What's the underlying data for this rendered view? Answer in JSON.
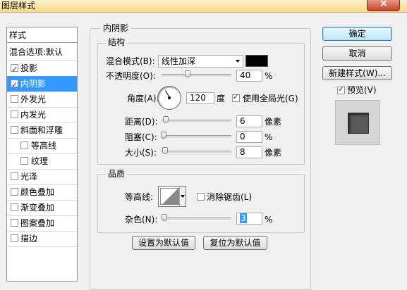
{
  "window": {
    "title": "图层样式"
  },
  "sidebar": {
    "header": "样式",
    "items": [
      {
        "label": "混合选项:默认",
        "checkbox": false,
        "checked": false,
        "selected": false
      },
      {
        "label": "投影",
        "checkbox": true,
        "checked": true,
        "selected": false
      },
      {
        "label": "内阴影",
        "checkbox": true,
        "checked": true,
        "selected": true
      },
      {
        "label": "外发光",
        "checkbox": true,
        "checked": false,
        "selected": false
      },
      {
        "label": "内发光",
        "checkbox": true,
        "checked": false,
        "selected": false
      },
      {
        "label": "斜面和浮雕",
        "checkbox": true,
        "checked": false,
        "selected": false
      },
      {
        "label": "等高线",
        "checkbox": true,
        "checked": false,
        "selected": false,
        "indent": true
      },
      {
        "label": "纹理",
        "checkbox": true,
        "checked": false,
        "selected": false,
        "indent": true
      },
      {
        "label": "光泽",
        "checkbox": true,
        "checked": false,
        "selected": false
      },
      {
        "label": "颜色叠加",
        "checkbox": true,
        "checked": false,
        "selected": false
      },
      {
        "label": "渐变叠加",
        "checkbox": true,
        "checked": false,
        "selected": false
      },
      {
        "label": "图案叠加",
        "checkbox": true,
        "checked": false,
        "selected": false
      },
      {
        "label": "描边",
        "checkbox": true,
        "checked": false,
        "selected": false
      }
    ]
  },
  "inner_shadow": {
    "title": "内阴影",
    "structure": {
      "title": "结构",
      "blend_mode_label": "混合模式(B):",
      "blend_mode_value": "线性加深",
      "color": "#000000",
      "opacity_label": "不透明度(O):",
      "opacity_value": "40",
      "opacity_unit": "%",
      "angle_label": "角度(A):",
      "angle_value": "120",
      "angle_unit": "度",
      "global_light_label": "使用全局光(G)",
      "global_light_checked": true,
      "distance_label": "距离(D):",
      "distance_value": "6",
      "distance_unit": "像素",
      "choke_label": "阻塞(C):",
      "choke_value": "0",
      "choke_unit": "%",
      "size_label": "大小(S):",
      "size_value": "8",
      "size_unit": "像素"
    },
    "quality": {
      "title": "品质",
      "contour_label": "等高线:",
      "antialias_label": "消除锯齿(L)",
      "antialias_checked": false,
      "noise_label": "杂色(N):",
      "noise_value": "3",
      "noise_unit": "%"
    },
    "make_default_label": "设置为默认值",
    "reset_default_label": "复位为默认值"
  },
  "actions": {
    "ok_label": "确定",
    "cancel_label": "取消",
    "new_style_label": "新建样式(W)...",
    "preview_label": "预览(V)",
    "preview_checked": true
  }
}
